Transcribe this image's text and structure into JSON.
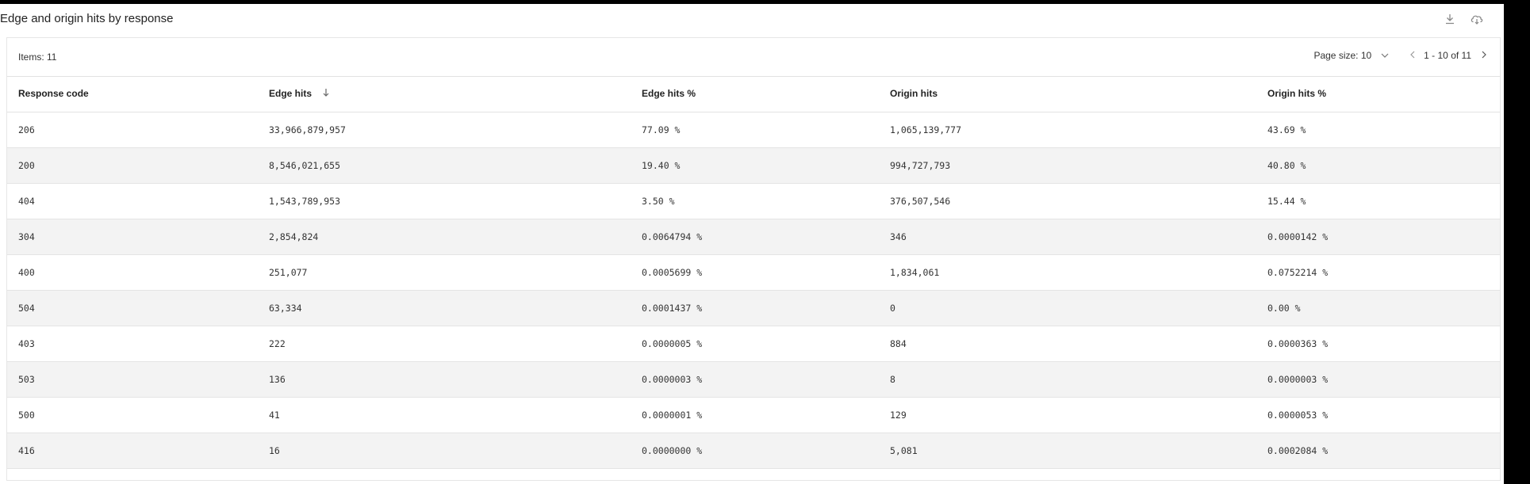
{
  "widget": {
    "title": "Edge and origin hits by response"
  },
  "toolbar": {
    "items_label": "Items: 11",
    "page_size_label": "Page size: 10",
    "range_label": "1 - 10 of 11"
  },
  "icons": {
    "download": "download-icon",
    "cloud": "cloud-download-icon",
    "sort": "sort-down-arrow-icon",
    "prev": "chevron-left-icon",
    "next": "chevron-right-icon",
    "dropdown": "chevron-down-icon"
  },
  "table": {
    "columns": [
      "Response code",
      "Edge hits",
      "Edge hits %",
      "Origin hits",
      "Origin hits %"
    ],
    "rows": [
      [
        "206",
        "33,966,879,957",
        "77.09 %",
        "1,065,139,777",
        "43.69 %"
      ],
      [
        "200",
        "8,546,021,655",
        "19.40 %",
        "994,727,793",
        "40.80 %"
      ],
      [
        "404",
        "1,543,789,953",
        "3.50 %",
        "376,507,546",
        "15.44 %"
      ],
      [
        "304",
        "2,854,824",
        "0.0064794 %",
        "346",
        "0.0000142 %"
      ],
      [
        "400",
        "251,077",
        "0.0005699 %",
        "1,834,061",
        "0.0752214 %"
      ],
      [
        "504",
        "63,334",
        "0.0001437 %",
        "0",
        "0.00 %"
      ],
      [
        "403",
        "222",
        "0.0000005 %",
        "884",
        "0.0000363 %"
      ],
      [
        "503",
        "136",
        "0.0000003 %",
        "8",
        "0.0000003 %"
      ],
      [
        "500",
        "41",
        "0.0000001 %",
        "129",
        "0.0000053 %"
      ],
      [
        "416",
        "16",
        "0.0000000 %",
        "5,081",
        "0.0002084 %"
      ]
    ]
  },
  "colors": {
    "row_alt_bg": "#f3f3f3",
    "border": "#e2e2e2",
    "text": "#222222"
  }
}
